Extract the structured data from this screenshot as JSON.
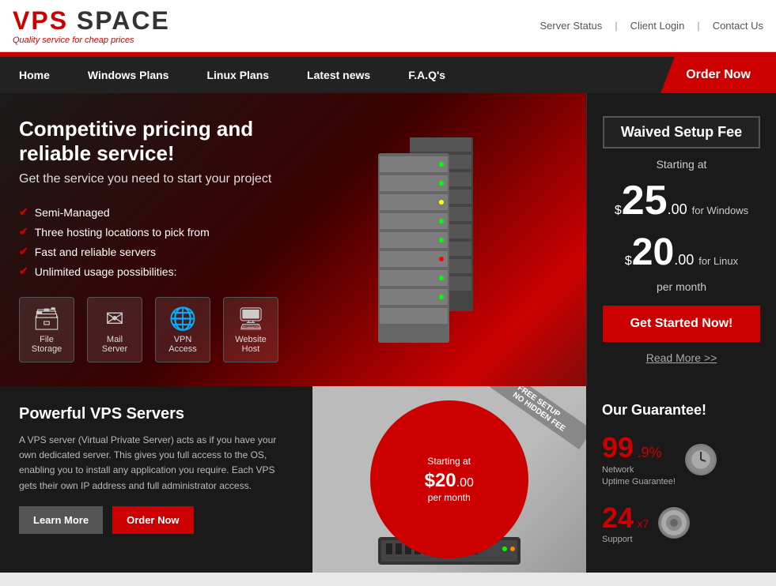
{
  "header": {
    "logo_vps": "VPS",
    "logo_space": " SPACE",
    "logo_tagline": "Quality service for cheap prices",
    "server_status": "Server Status",
    "client_login": "Client Login",
    "contact_us": "Contact Us"
  },
  "nav": {
    "home": "Home",
    "windows_plans": "Windows Plans",
    "linux_plans": "Linux Plans",
    "latest_news": "Latest news",
    "faq": "F.A.Q's",
    "order_now": "Order Now"
  },
  "hero": {
    "headline": "Competitive pricing and reliable service!",
    "subheadline": "Get the service you need to start your project",
    "features": [
      "Semi-Managed",
      "Three hosting locations to pick from",
      "Fast and reliable servers",
      "Unlimited usage possibilities:"
    ],
    "icons": [
      {
        "label": "File\nStorage",
        "glyph": "🗃"
      },
      {
        "label": "Mail\nServer",
        "glyph": "📧"
      },
      {
        "label": "VPN\nAccess",
        "glyph": "🌐"
      },
      {
        "label": "Website\nHost",
        "glyph": "🖥"
      }
    ],
    "pricing": {
      "badge": "Waived Setup Fee",
      "starting_at": "Starting at",
      "windows_dollar": "$",
      "windows_price": "25",
      "windows_cents": ".00",
      "windows_label": "for Windows",
      "linux_dollar": "$",
      "linux_price": "20",
      "linux_cents": ".00",
      "linux_label": "for Linux",
      "per_month": "per month",
      "get_started": "Get Started Now!",
      "read_more": "Read More >>"
    }
  },
  "lower": {
    "vps_title": "Powerful VPS Servers",
    "vps_description": "A VPS server (Virtual Private Server) acts as if you have your own dedicated server. This gives you full access to the OS, enabling you to install any application you require. Each VPS gets their own IP address and full administrator access.",
    "learn_more": "Learn More",
    "order_now": "Order Now",
    "promo": {
      "free_setup": "FREE SETUP",
      "no_hidden": "NO HIDDEN FEE",
      "starting_at": "Starting at",
      "price": "$20",
      "cents": ".00",
      "per_month": "per month"
    },
    "guarantee": {
      "title": "Our Guarantee!",
      "uptime_number": "99",
      "uptime_sub": ".9% Network\nUptime Guarantee!",
      "support_number": "24",
      "support_sub": "x7 Support"
    }
  }
}
